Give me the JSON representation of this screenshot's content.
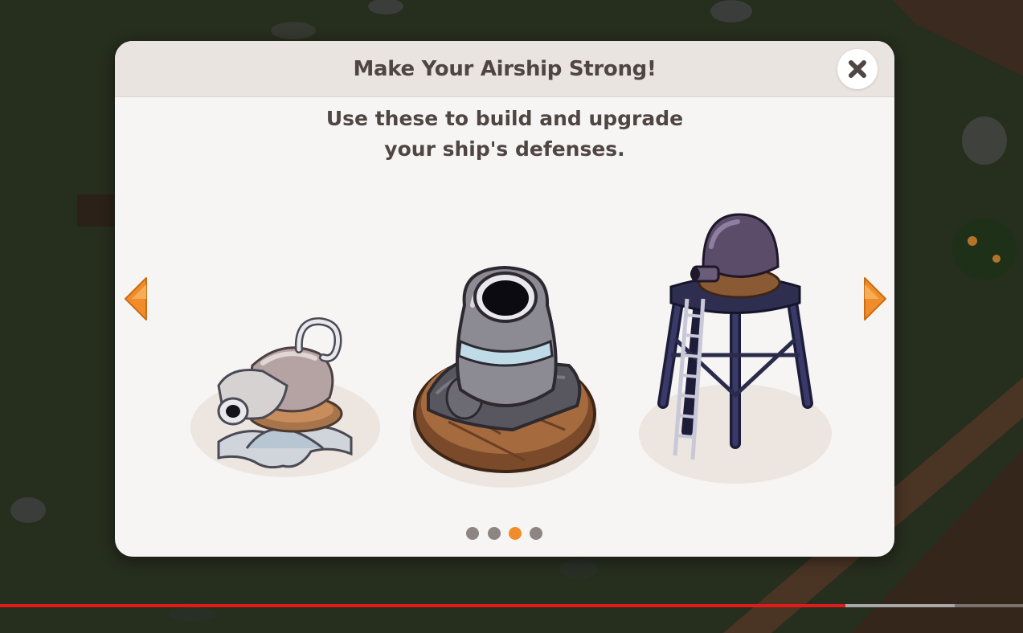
{
  "dialog": {
    "title": "Make Your Airship Strong!",
    "subtitle_line1": "Use these to build and upgrade",
    "subtitle_line2": "your ship's defenses."
  },
  "defenses": [
    {
      "icon": "machine-gun-icon"
    },
    {
      "icon": "mortar-cannon-icon"
    },
    {
      "icon": "sniper-tower-icon"
    }
  ],
  "pagination": {
    "total": 4,
    "active_index": 2
  },
  "colors": {
    "accent_orange": "#f08d2a",
    "header_bg": "#eae4e0",
    "text": "#4f4644",
    "video_progress": "#e11b1b"
  },
  "video": {
    "progress_fraction": 0.827,
    "buffered_fraction": 0.934
  }
}
